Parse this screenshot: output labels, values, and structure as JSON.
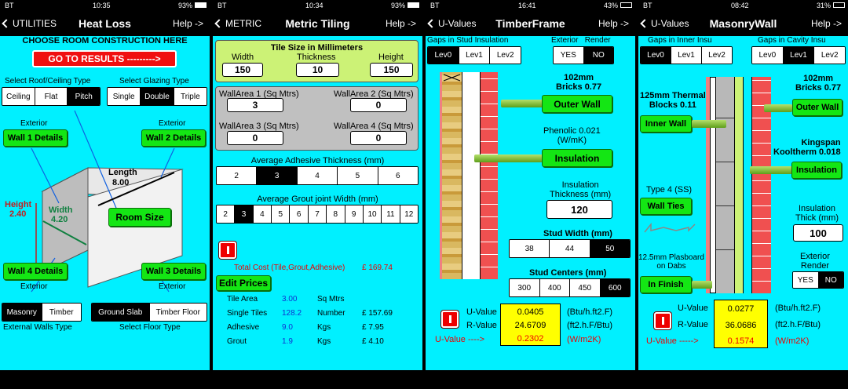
{
  "screens": [
    {
      "status": {
        "carrier": "BT",
        "time": "10:35",
        "battery": "93%"
      },
      "nav": {
        "back": "UTILITIES",
        "title": "Heat Loss",
        "help": "Help ->"
      },
      "choose_label": "CHOOSE ROOM CONSTRUCTION HERE",
      "results_button": "GO TO RESULTS --------->",
      "roof_label": "Select Roof/Ceiling Type",
      "roof_options": [
        "Ceiling",
        "Flat",
        "Pitch"
      ],
      "roof_selected": "Pitch",
      "glazing_label": "Select Glazing Type",
      "glazing_options": [
        "Single",
        "Double",
        "Triple"
      ],
      "glazing_selected": "Double",
      "exterior": "Exterior",
      "wall1": "Wall 1 Details",
      "wall2": "Wall 2 Details",
      "wall3": "Wall 3 Details",
      "wall4": "Wall 4 Details",
      "length_label": "Length",
      "length_value": "8.00",
      "height_label": "Height",
      "height_value": "2.40",
      "width_label": "Width",
      "width_value": "4.20",
      "room_size": "Room Size",
      "walls_options": [
        "Masonry",
        "Timber"
      ],
      "walls_selected": "Masonry",
      "walls_label": "External Walls Type",
      "floor_options": [
        "Ground Slab",
        "Timber Floor"
      ],
      "floor_selected": "Ground Slab",
      "floor_label": "Select Floor Type"
    },
    {
      "status": {
        "carrier": "BT",
        "time": "10:34",
        "battery": "93%"
      },
      "nav": {
        "back": "METRIC",
        "title": "Metric Tiling",
        "help": "Help ->"
      },
      "tile_title": "Tile Size in Millimeters",
      "tile_width_label": "Width",
      "tile_width": "150",
      "tile_thick_label": "Thickness",
      "tile_thick": "10",
      "tile_height_label": "Height",
      "tile_height": "150",
      "wa1_label": "WallArea 1 (Sq Mtrs)",
      "wa1": "3",
      "wa2_label": "WallArea 2 (Sq Mtrs)",
      "wa2": "0",
      "wa3_label": "WallArea 3 (Sq Mtrs)",
      "wa3": "0",
      "wa4_label": "WallArea 4 (Sq Mtrs)",
      "wa4": "0",
      "adhesive_label": "Average Adhesive Thickness (mm)",
      "adhesive_options": [
        "2",
        "3",
        "4",
        "5",
        "6"
      ],
      "adhesive_selected": "3",
      "grout_label": "Average Grout joint Width (mm)",
      "grout_options": [
        "2",
        "3",
        "4",
        "5",
        "6",
        "7",
        "8",
        "9",
        "10",
        "11",
        "12"
      ],
      "grout_selected": "3",
      "total_label": "Total Cost (Tile,Grout,Adhesive)",
      "total_value": "£ 169.74",
      "edit_prices": "Edit Prices",
      "rows": [
        {
          "name": "Tile Area",
          "qty": "3.00",
          "unit": "Sq Mtrs",
          "cost": ""
        },
        {
          "name": "Single Tiles",
          "qty": "128.2",
          "unit": "Number",
          "cost": "£ 157.69"
        },
        {
          "name": "Adhesive",
          "qty": "9.0",
          "unit": "Kgs",
          "cost": "£ 7.95"
        },
        {
          "name": "Grout",
          "qty": "1.9",
          "unit": "Kgs",
          "cost": "£ 4.10"
        }
      ]
    },
    {
      "status": {
        "carrier": "BT",
        "time": "16:41",
        "battery": "43%"
      },
      "nav": {
        "back": "U-Values",
        "title": "TimberFrame",
        "help": "Help ->"
      },
      "gaps_label": "Gaps in Stud Insulation",
      "gap_options": [
        "Lev0",
        "Lev1",
        "Lev2"
      ],
      "gap_selected": "Lev0",
      "render_label": "Exterior   Render",
      "render_options": [
        "YES",
        "NO"
      ],
      "render_selected": "NO",
      "bricks_label": "102mm\nBricks 0.77",
      "outer_wall": "Outer Wall",
      "phenolic_label": "Phenolic 0.021\n(W/mK)",
      "insulation": "Insulation",
      "ins_thick_label": "Insulation\nThickness (mm)",
      "ins_thick": "120",
      "stud_width_label": "Stud Width (mm)",
      "stud_width_options": [
        "38",
        "44",
        "50"
      ],
      "stud_width_selected": "50",
      "stud_centers_label": "Stud Centers (mm)",
      "stud_centers_options": [
        "300",
        "400",
        "450",
        "600"
      ],
      "stud_centers_selected": "600",
      "u_label": "U-Value",
      "u_value": "0.0405",
      "u_unit": "(Btu/h.ft2.F)",
      "r_label": "R-Value",
      "r_value": "24.6709",
      "r_unit": "(ft2.h.F/Btu)",
      "um_label": "U-Value ---->",
      "um_value": "0.2302",
      "um_unit": "(W/m2K)"
    },
    {
      "status": {
        "carrier": "BT",
        "time": "08:42",
        "battery": "31%"
      },
      "nav": {
        "back": "U-Values",
        "title": "MasonryWall",
        "help": "Help ->"
      },
      "inner_gaps_label": "Gaps in Inner Insu",
      "inner_gap_options": [
        "Lev0",
        "Lev1",
        "Lev2"
      ],
      "inner_gap_selected": "Lev0",
      "cavity_gaps_label": "Gaps in Cavity Insu",
      "cavity_gap_options": [
        "Lev0",
        "Lev1",
        "Lev2"
      ],
      "cavity_gap_selected": "Lev1",
      "blocks_label": "125mm Thermal\nBlocks 0.11",
      "inner_wall": "Inner Wall",
      "bricks_label": "102mm\nBricks 0.77",
      "outer_wall": "Outer Wall",
      "kingspan_label": "Kingspan\nKooltherm 0.018",
      "insulation": "Insulation",
      "ties_label": "Type 4 (SS)",
      "wall_ties": "Wall Ties",
      "plasboard_label": "12.5mm Plasboard\non Dabs",
      "in_finish": "In Finish",
      "ins_thick_label": "Insulation\nThick (mm)",
      "ins_thick": "100",
      "render_label": "Exterior\nRender",
      "render_options": [
        "YES",
        "NO"
      ],
      "render_selected": "NO",
      "u_label": "U-Value",
      "u_value": "0.0277",
      "u_unit": "(Btu/h.ft2.F)",
      "r_label": "R-Value",
      "r_value": "36.0686",
      "r_unit": "(ft2.h.F/Btu)",
      "um_label": "U-Value ----->",
      "um_value": "0.1574",
      "um_unit": "(W/m2K)"
    }
  ],
  "colors": {
    "cyan": "#00f0ff",
    "green": "#14e614",
    "red": "#e00000",
    "yellow": "#ffff00",
    "lime_panel": "#ccf276",
    "gray_panel": "#c0c0c0"
  }
}
